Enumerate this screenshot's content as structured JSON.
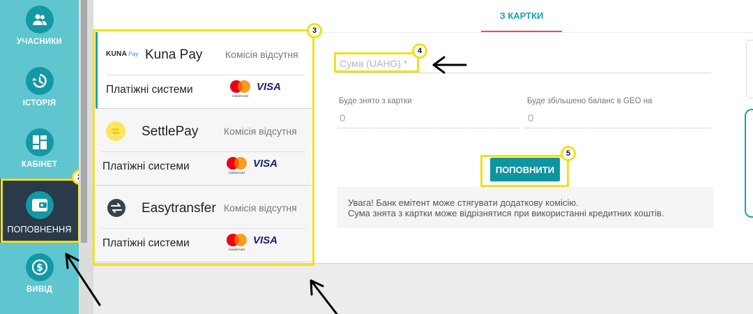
{
  "sidebar": {
    "items": [
      {
        "label": "УЧАСНИКИ",
        "icon": "users-icon"
      },
      {
        "label": "ІСТОРІЯ",
        "icon": "history-icon"
      },
      {
        "label": "КАБІНЕТ",
        "icon": "dashboard-icon"
      },
      {
        "label": "ПОПОВНЕННЯ",
        "icon": "wallet-icon",
        "active": true
      },
      {
        "label": "ВИВІД",
        "icon": "dollar-icon"
      }
    ]
  },
  "tab": {
    "label": "З КАРТКИ"
  },
  "providers": [
    {
      "name": "Kuna Pay",
      "logo_text": "KUNA",
      "logo_sub": "Pay",
      "fee": "Комісія відсутня",
      "systems_label": "Платіжні системи",
      "selected": true
    },
    {
      "name": "SettlePay",
      "fee": "Комісія відсутня",
      "systems_label": "Платіжні системи"
    },
    {
      "name": "Easytransfer",
      "fee": "Комісія відсутня",
      "systems_label": "Платіжні системи"
    }
  ],
  "cards": {
    "visa": "VISA",
    "mastercard": "mastercard"
  },
  "form": {
    "amount_placeholder": "Сума (UAHG) *",
    "charged_label": "Буде знято з картки",
    "charged_value": "0",
    "credited_label": "Буде збільшено баланс в GEO на",
    "credited_value": "0",
    "submit_label": "ПОПОВНИТИ",
    "notice_line1": "Увага! Банк емітент може стягувати додаткову комісію.",
    "notice_line2": "Сума знята з картки може відрізнятися при використанні кредитних коштів."
  },
  "annotations": {
    "badges": [
      "2",
      "3",
      "4",
      "5"
    ]
  },
  "colors": {
    "sidebar": "#5fc5cf",
    "icon_circle": "#1398a4",
    "active_nav": "#2a3a4a",
    "accent": "#16a2af",
    "tab_underline": "#e2524f",
    "highlight": "#f4df1a",
    "button": "#0e95a0"
  }
}
